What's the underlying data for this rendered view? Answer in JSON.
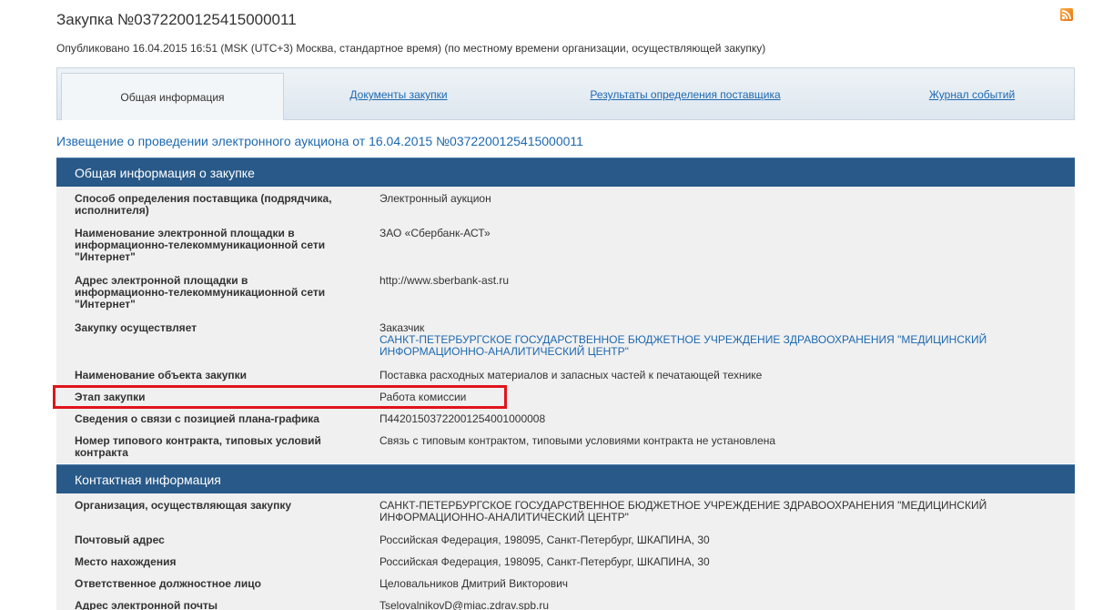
{
  "header": {
    "title": "Закупка №0372200125415000011",
    "published": "Опубликовано 16.04.2015 16:51 (MSK (UTC+3) Москва, стандартное время) (по местному времени организации, осуществляющей закупку)",
    "rss_icon": "rss-icon"
  },
  "tabs": [
    {
      "label": "Общая информация",
      "active": true
    },
    {
      "label": "Документы закупки",
      "active": false
    },
    {
      "label": "Результаты определения поставщика",
      "active": false
    },
    {
      "label": "Журнал событий",
      "active": false
    }
  ],
  "notice_title": "Извещение о проведении электронного аукциона от 16.04.2015 №0372200125415000011",
  "general": {
    "header": "Общая информация о закупке",
    "rows": [
      {
        "label": "Способ определения поставщика (подрядчика, исполнителя)",
        "value": "Электронный аукцион"
      },
      {
        "label": "Наименование электронной площадки в информационно-телекоммуникационной сети \"Интернет\"",
        "value": "ЗАО «Сбербанк-АСТ»"
      },
      {
        "label": "Адрес электронной площадки в информационно-телекоммуникационной сети \"Интернет\"",
        "value": "http://www.sberbank-ast.ru"
      },
      {
        "label": "Закупку осуществляет",
        "value": "Заказчик",
        "value_link": "САНКТ-ПЕТЕРБУРГСКОЕ ГОСУДАРСТВЕННОЕ БЮДЖЕТНОЕ УЧРЕЖДЕНИЕ ЗДРАВООХРАНЕНИЯ \"МЕДИЦИНСКИЙ ИНФОРМАЦИОННО-АНАЛИТИЧЕСКИЙ ЦЕНТР\""
      },
      {
        "label": "Наименование объекта закупки",
        "value": "Поставка расходных материалов и запасных частей к печатающей технике"
      },
      {
        "label": "Этап закупки",
        "value": "Работа комиссии"
      },
      {
        "label": "Сведения о связи с позицией плана-графика",
        "value_link": "П44201503722001254001000008"
      },
      {
        "label": "Номер типового контракта, типовых условий контракта",
        "value": "Связь с типовым контрактом, типовыми условиями контракта не установлена"
      }
    ]
  },
  "contact": {
    "header": "Контактная информация",
    "rows": [
      {
        "label": "Организация, осуществляющая закупку",
        "value": "САНКТ-ПЕТЕРБУРГСКОЕ ГОСУДАРСТВЕННОЕ БЮДЖЕТНОЕ УЧРЕЖДЕНИЕ ЗДРАВООХРАНЕНИЯ \"МЕДИЦИНСКИЙ ИНФОРМАЦИОННО-АНАЛИТИЧЕСКИЙ ЦЕНТР\""
      },
      {
        "label": "Почтовый адрес",
        "value": "Российская Федерация, 198095, Санкт-Петербург, ШКАПИНА, 30"
      },
      {
        "label": "Место нахождения",
        "value": "Российская Федерация, 198095, Санкт-Петербург, ШКАПИНА, 30"
      },
      {
        "label": "Ответственное должностное лицо",
        "value": "Целовальников Дмитрий Викторович"
      },
      {
        "label": "Адрес электронной почты",
        "value": "TselovalnikovD@miac.zdrav.spb.ru"
      }
    ]
  },
  "colors": {
    "link": "#1d69b0",
    "section_header": "#285988",
    "highlight": "#e0141b"
  }
}
